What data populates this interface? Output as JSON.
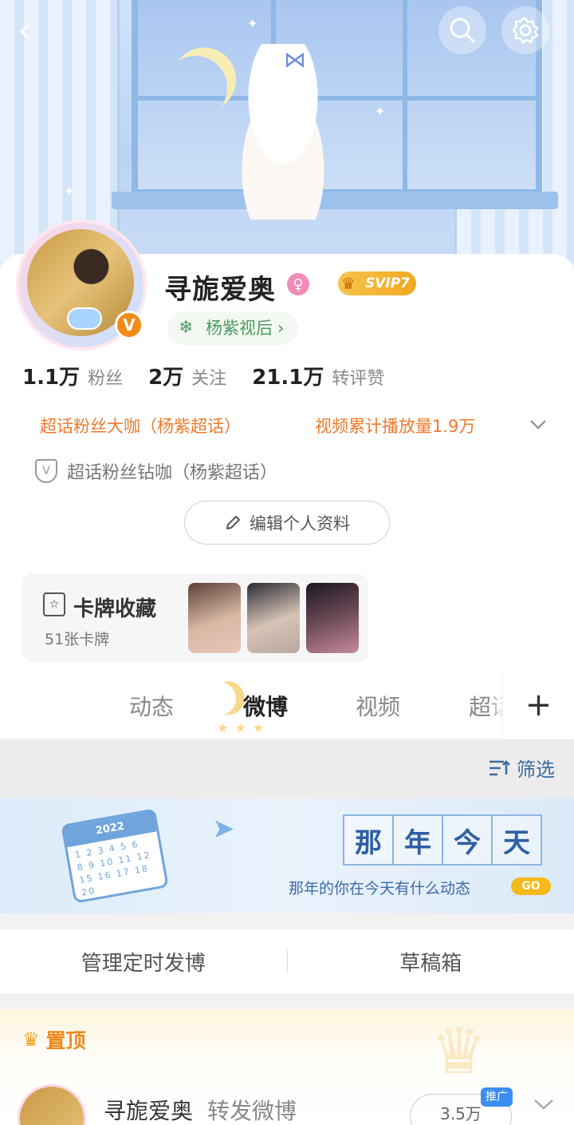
{
  "header": {
    "back_icon": "chevron-left-icon",
    "search_icon": "search-icon",
    "settings_icon": "gear-icon"
  },
  "profile": {
    "username": "寻旎爱奥",
    "gender_icon": "female-icon",
    "vip_badge": "SVIP7",
    "verified_badge": "V",
    "tag": "杨紫视后",
    "stats": [
      {
        "value": "1.1万",
        "label": "粉丝"
      },
      {
        "value": "2万",
        "label": "关注"
      },
      {
        "value": "21.1万",
        "label": "转评赞"
      }
    ],
    "honors": [
      "超话粉丝大咖（杨紫超话）",
      "视频累计播放量1.9万"
    ],
    "fan_badge": "超话粉丝钻咖（杨紫超话）",
    "edit_button": "编辑个人资料"
  },
  "card_collection": {
    "title": "卡牌收藏",
    "count": "51张卡牌"
  },
  "tabs": [
    {
      "label": "动态"
    },
    {
      "label": "微博",
      "active": true
    },
    {
      "label": "视频"
    },
    {
      "label": "超话"
    }
  ],
  "filter": {
    "label": "筛选"
  },
  "promo": {
    "calendar_year": "2022",
    "title_chars": [
      "那",
      "年",
      "今",
      "天"
    ],
    "subtitle": "那年的你在今天有什么动态",
    "go_label": "GO"
  },
  "actions": {
    "scheduled": "管理定时发博",
    "drafts": "草稿箱"
  },
  "pinned": {
    "label": "置顶",
    "author": "寻旎爱奥",
    "action": "转发微博",
    "hot_value": "3.5万",
    "promote_badge": "推广"
  },
  "colors": {
    "accent_orange": "#ef7a2c",
    "link_blue": "#3c6c9e",
    "tag_green": "#4a9b5e",
    "vip_gold": "#f0a821"
  }
}
